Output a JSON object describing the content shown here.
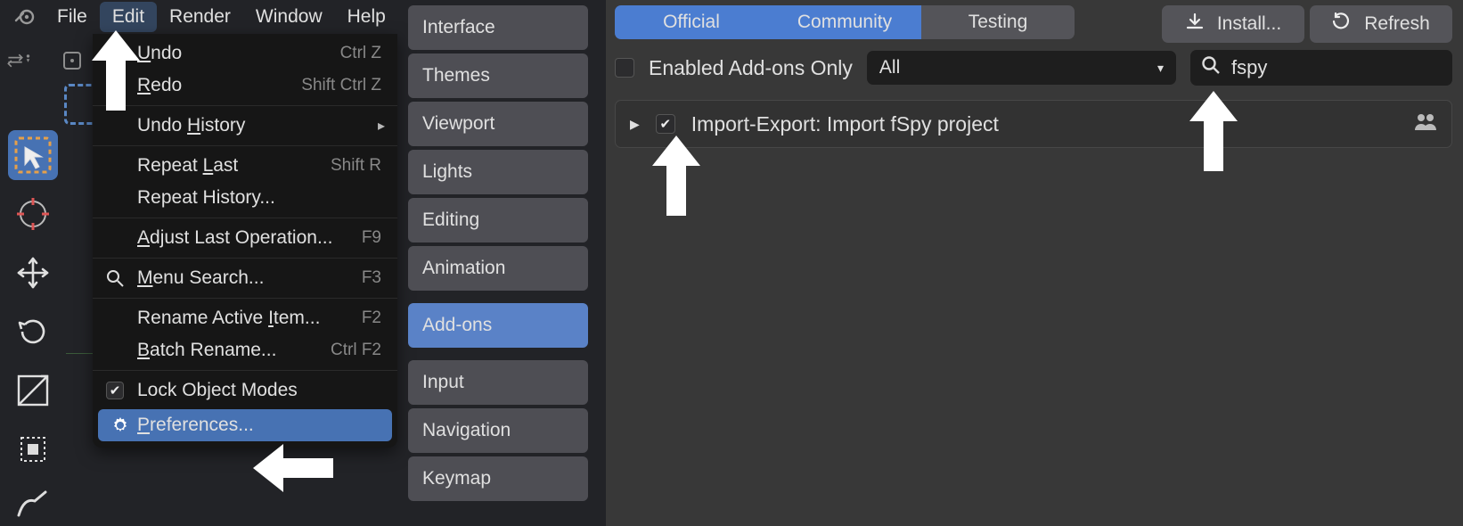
{
  "menubar": {
    "items": [
      "File",
      "Edit",
      "Render",
      "Window",
      "Help"
    ],
    "active_index": 1
  },
  "edit_menu": {
    "undo": {
      "label": "Undo",
      "shortcut": "Ctrl Z"
    },
    "redo": {
      "label": "Redo",
      "shortcut": "Shift Ctrl Z"
    },
    "undo_history": {
      "label": "Undo History"
    },
    "repeat_last": {
      "label": "Repeat Last",
      "shortcut": "Shift R"
    },
    "repeat_history": {
      "label": "Repeat History..."
    },
    "adjust_last": {
      "label": "Adjust Last Operation...",
      "shortcut": "F9"
    },
    "menu_search": {
      "label": "Menu Search...",
      "shortcut": "F3"
    },
    "rename_active": {
      "label": "Rename Active Item...",
      "shortcut": "F2"
    },
    "batch_rename": {
      "label": "Batch Rename...",
      "shortcut": "Ctrl F2"
    },
    "lock_modes": {
      "label": "Lock Object Modes"
    },
    "preferences": {
      "label": "Preferences..."
    }
  },
  "pref_tabs": [
    "Interface",
    "Themes",
    "Viewport",
    "Lights",
    "Editing",
    "Animation",
    "Add-ons",
    "Input",
    "Navigation",
    "Keymap"
  ],
  "pref_tabs_active_index": 6,
  "addon_catalog_tabs": {
    "official": "Official",
    "community": "Community",
    "testing": "Testing"
  },
  "buttons": {
    "install": "Install...",
    "refresh": "Refresh"
  },
  "filters": {
    "enabled_only_label": "Enabled Add-ons Only",
    "enabled_only_checked": false,
    "category_value": "All",
    "search_value": "fspy"
  },
  "addon": {
    "enabled": true,
    "label": "Import-Export: Import fSpy project"
  }
}
